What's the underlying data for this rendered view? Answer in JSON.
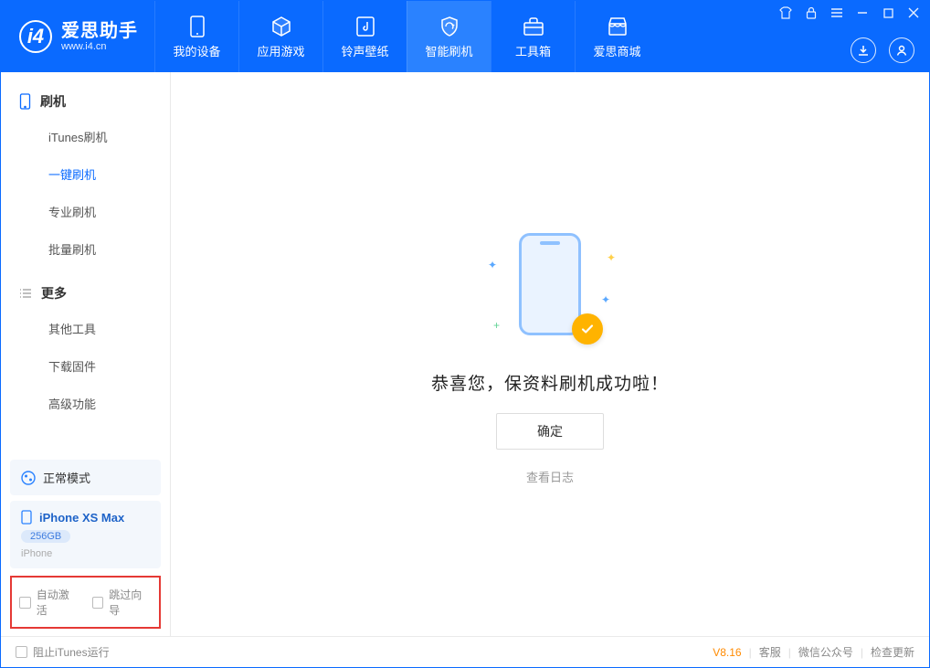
{
  "header": {
    "app_name": "爱思助手",
    "app_domain": "www.i4.cn",
    "tabs": [
      {
        "label": "我的设备",
        "icon": "device-icon"
      },
      {
        "label": "应用游戏",
        "icon": "cube-icon"
      },
      {
        "label": "铃声壁纸",
        "icon": "music-note-icon"
      },
      {
        "label": "智能刷机",
        "icon": "shield-refresh-icon",
        "active": true
      },
      {
        "label": "工具箱",
        "icon": "toolbox-icon"
      },
      {
        "label": "爱思商城",
        "icon": "storefront-icon"
      }
    ]
  },
  "sidebar": {
    "group1": {
      "title": "刷机",
      "items": [
        "iTunes刷机",
        "一键刷机",
        "专业刷机",
        "批量刷机"
      ],
      "active_index": 1
    },
    "group2": {
      "title": "更多",
      "items": [
        "其他工具",
        "下载固件",
        "高级功能"
      ]
    },
    "mode_card": {
      "label": "正常模式"
    },
    "device_card": {
      "name": "iPhone XS Max",
      "capacity": "256GB",
      "type": "iPhone"
    },
    "options": {
      "auto_activate": "自动激活",
      "skip_guide": "跳过向导"
    }
  },
  "main": {
    "success_title": "恭喜您，保资料刷机成功啦！",
    "ok_button": "确定",
    "view_log": "查看日志"
  },
  "footer": {
    "block_itunes": "阻止iTunes运行",
    "version": "V8.16",
    "links": [
      "客服",
      "微信公众号",
      "检查更新"
    ]
  }
}
